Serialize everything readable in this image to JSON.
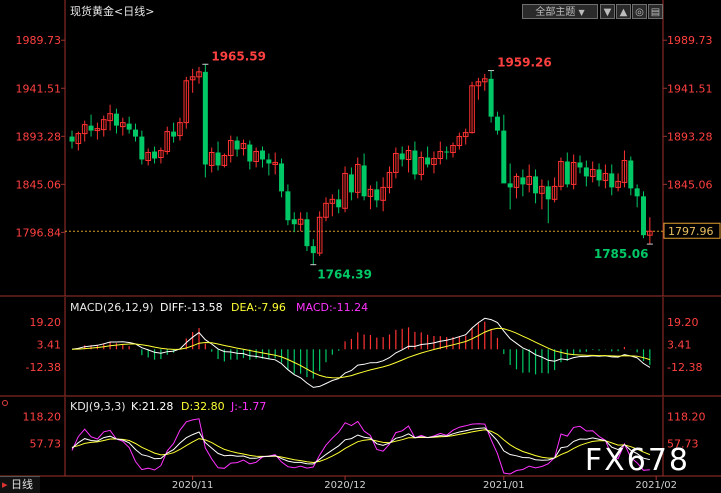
{
  "header": {
    "instrument": "现货黄金",
    "period": "<日线>",
    "theme_button": "全部主题",
    "theme_arrow": "▼",
    "theme_arrow_icon": "dropdown-triangle-icon",
    "nav_buttons": [
      "▼",
      "▲",
      "◎",
      "▤"
    ]
  },
  "watermark": "FX678",
  "bottom_tab": "日线",
  "colors": {
    "up": "#ff3232",
    "down": "#00c866",
    "diff": "#ffffff",
    "dea": "#ffff33",
    "macd": "#ff33ff",
    "k": "#ffffff",
    "d": "#ffff33",
    "j": "#ff33ff",
    "axis": "#a0322d",
    "price_label": "#ff4040"
  },
  "chart_data": [
    {
      "type": "candlestick",
      "title": "现货黄金<日线>",
      "y_ticks": [
        "1989.73",
        "1941.51",
        "1893.28",
        "1845.06",
        "1796.84"
      ],
      "ylim": [
        1745,
        2002
      ],
      "x_ticks": [
        {
          "label": "2020/11",
          "index": 19
        },
        {
          "label": "2020/12",
          "index": 43
        },
        {
          "label": "2021/01",
          "index": 68
        },
        {
          "label": "2021/02",
          "index": 92
        }
      ],
      "annotations": [
        {
          "text": "1965.59",
          "index": 21,
          "value": 1965.59,
          "kind": "high"
        },
        {
          "text": "1764.39",
          "index": 38,
          "value": 1764.39,
          "kind": "low"
        },
        {
          "text": "1959.26",
          "index": 66,
          "value": 1959.26,
          "kind": "high"
        },
        {
          "text": "1785.06",
          "index": 91,
          "value": 1785.06,
          "kind": "low"
        }
      ],
      "current_price": "1797.96",
      "candles": [
        {
          "o": 1893,
          "h": 1899,
          "l": 1881,
          "c": 1888
        },
        {
          "o": 1886,
          "h": 1898,
          "l": 1879,
          "c": 1896
        },
        {
          "o": 1896,
          "h": 1909,
          "l": 1888,
          "c": 1905
        },
        {
          "o": 1904,
          "h": 1915,
          "l": 1893,
          "c": 1899
        },
        {
          "o": 1899,
          "h": 1907,
          "l": 1890,
          "c": 1901
        },
        {
          "o": 1900,
          "h": 1914,
          "l": 1893,
          "c": 1910
        },
        {
          "o": 1909,
          "h": 1925,
          "l": 1899,
          "c": 1916
        },
        {
          "o": 1916,
          "h": 1921,
          "l": 1896,
          "c": 1904
        },
        {
          "o": 1903,
          "h": 1912,
          "l": 1894,
          "c": 1907
        },
        {
          "o": 1906,
          "h": 1913,
          "l": 1896,
          "c": 1900
        },
        {
          "o": 1900,
          "h": 1906,
          "l": 1888,
          "c": 1893
        },
        {
          "o": 1893,
          "h": 1899,
          "l": 1865,
          "c": 1870
        },
        {
          "o": 1869,
          "h": 1881,
          "l": 1864,
          "c": 1877
        },
        {
          "o": 1878,
          "h": 1883,
          "l": 1866,
          "c": 1871
        },
        {
          "o": 1872,
          "h": 1882,
          "l": 1866,
          "c": 1879
        },
        {
          "o": 1878,
          "h": 1903,
          "l": 1875,
          "c": 1898
        },
        {
          "o": 1898,
          "h": 1907,
          "l": 1887,
          "c": 1893
        },
        {
          "o": 1894,
          "h": 1912,
          "l": 1889,
          "c": 1907
        },
        {
          "o": 1907,
          "h": 1953,
          "l": 1901,
          "c": 1949
        },
        {
          "o": 1950,
          "h": 1961,
          "l": 1937,
          "c": 1953
        },
        {
          "o": 1953,
          "h": 1963,
          "l": 1946,
          "c": 1958
        },
        {
          "o": 1958,
          "h": 1966,
          "l": 1852,
          "c": 1865
        },
        {
          "o": 1864,
          "h": 1882,
          "l": 1857,
          "c": 1877
        },
        {
          "o": 1877,
          "h": 1888,
          "l": 1859,
          "c": 1864
        },
        {
          "o": 1864,
          "h": 1876,
          "l": 1862,
          "c": 1874
        },
        {
          "o": 1874,
          "h": 1894,
          "l": 1867,
          "c": 1889
        },
        {
          "o": 1889,
          "h": 1893,
          "l": 1873,
          "c": 1880
        },
        {
          "o": 1881,
          "h": 1890,
          "l": 1874,
          "c": 1886
        },
        {
          "o": 1885,
          "h": 1889,
          "l": 1860,
          "c": 1868
        },
        {
          "o": 1868,
          "h": 1882,
          "l": 1862,
          "c": 1878
        },
        {
          "o": 1879,
          "h": 1883,
          "l": 1862,
          "c": 1870
        },
        {
          "o": 1870,
          "h": 1876,
          "l": 1854,
          "c": 1866
        },
        {
          "o": 1865,
          "h": 1877,
          "l": 1855,
          "c": 1867
        },
        {
          "o": 1866,
          "h": 1871,
          "l": 1832,
          "c": 1838
        },
        {
          "o": 1838,
          "h": 1845,
          "l": 1804,
          "c": 1809
        },
        {
          "o": 1810,
          "h": 1817,
          "l": 1797,
          "c": 1805
        },
        {
          "o": 1805,
          "h": 1817,
          "l": 1798,
          "c": 1810
        },
        {
          "o": 1810,
          "h": 1817,
          "l": 1778,
          "c": 1783
        },
        {
          "o": 1783,
          "h": 1790,
          "l": 1764,
          "c": 1776
        },
        {
          "o": 1776,
          "h": 1818,
          "l": 1773,
          "c": 1812
        },
        {
          "o": 1812,
          "h": 1832,
          "l": 1808,
          "c": 1826
        },
        {
          "o": 1826,
          "h": 1835,
          "l": 1813,
          "c": 1830
        },
        {
          "o": 1830,
          "h": 1840,
          "l": 1816,
          "c": 1822
        },
        {
          "o": 1821,
          "h": 1863,
          "l": 1817,
          "c": 1856
        },
        {
          "o": 1855,
          "h": 1862,
          "l": 1829,
          "c": 1837
        },
        {
          "o": 1837,
          "h": 1872,
          "l": 1831,
          "c": 1865
        },
        {
          "o": 1864,
          "h": 1876,
          "l": 1829,
          "c": 1833
        },
        {
          "o": 1833,
          "h": 1844,
          "l": 1820,
          "c": 1840
        },
        {
          "o": 1840,
          "h": 1848,
          "l": 1822,
          "c": 1829
        },
        {
          "o": 1829,
          "h": 1852,
          "l": 1818,
          "c": 1842
        },
        {
          "o": 1842,
          "h": 1863,
          "l": 1836,
          "c": 1857
        },
        {
          "o": 1857,
          "h": 1882,
          "l": 1851,
          "c": 1876
        },
        {
          "o": 1876,
          "h": 1883,
          "l": 1863,
          "c": 1870
        },
        {
          "o": 1870,
          "h": 1884,
          "l": 1857,
          "c": 1879
        },
        {
          "o": 1879,
          "h": 1888,
          "l": 1850,
          "c": 1855
        },
        {
          "o": 1855,
          "h": 1878,
          "l": 1849,
          "c": 1872
        },
        {
          "o": 1872,
          "h": 1883,
          "l": 1862,
          "c": 1865
        },
        {
          "o": 1865,
          "h": 1878,
          "l": 1856,
          "c": 1871
        },
        {
          "o": 1871,
          "h": 1888,
          "l": 1865,
          "c": 1878
        },
        {
          "o": 1878,
          "h": 1883,
          "l": 1870,
          "c": 1877
        },
        {
          "o": 1877,
          "h": 1887,
          "l": 1872,
          "c": 1884
        },
        {
          "o": 1884,
          "h": 1897,
          "l": 1880,
          "c": 1893
        },
        {
          "o": 1893,
          "h": 1901,
          "l": 1885,
          "c": 1897
        },
        {
          "o": 1897,
          "h": 1948,
          "l": 1896,
          "c": 1944
        },
        {
          "o": 1944,
          "h": 1952,
          "l": 1930,
          "c": 1948
        },
        {
          "o": 1948,
          "h": 1956,
          "l": 1939,
          "c": 1951
        },
        {
          "o": 1951,
          "h": 1959,
          "l": 1907,
          "c": 1913
        },
        {
          "o": 1913,
          "h": 1918,
          "l": 1895,
          "c": 1899
        },
        {
          "o": 1899,
          "h": 1915,
          "l": 1852,
          "c": 1846
        },
        {
          "o": 1846,
          "h": 1866,
          "l": 1820,
          "c": 1842
        },
        {
          "o": 1842,
          "h": 1856,
          "l": 1831,
          "c": 1853
        },
        {
          "o": 1852,
          "h": 1860,
          "l": 1833,
          "c": 1845
        },
        {
          "o": 1845,
          "h": 1865,
          "l": 1837,
          "c": 1853
        },
        {
          "o": 1853,
          "h": 1860,
          "l": 1826,
          "c": 1836
        },
        {
          "o": 1836,
          "h": 1850,
          "l": 1820,
          "c": 1843
        },
        {
          "o": 1843,
          "h": 1849,
          "l": 1806,
          "c": 1830
        },
        {
          "o": 1830,
          "h": 1852,
          "l": 1827,
          "c": 1843
        },
        {
          "o": 1843,
          "h": 1872,
          "l": 1839,
          "c": 1868
        },
        {
          "o": 1868,
          "h": 1877,
          "l": 1842,
          "c": 1845
        },
        {
          "o": 1845,
          "h": 1875,
          "l": 1840,
          "c": 1867
        },
        {
          "o": 1867,
          "h": 1874,
          "l": 1856,
          "c": 1862
        },
        {
          "o": 1862,
          "h": 1869,
          "l": 1843,
          "c": 1853
        },
        {
          "o": 1853,
          "h": 1868,
          "l": 1847,
          "c": 1860
        },
        {
          "o": 1860,
          "h": 1866,
          "l": 1843,
          "c": 1849
        },
        {
          "o": 1849,
          "h": 1865,
          "l": 1841,
          "c": 1856
        },
        {
          "o": 1856,
          "h": 1865,
          "l": 1834,
          "c": 1842
        },
        {
          "o": 1842,
          "h": 1856,
          "l": 1838,
          "c": 1848
        },
        {
          "o": 1847,
          "h": 1879,
          "l": 1842,
          "c": 1869
        },
        {
          "o": 1869,
          "h": 1873,
          "l": 1834,
          "c": 1841
        },
        {
          "o": 1841,
          "h": 1845,
          "l": 1822,
          "c": 1833
        },
        {
          "o": 1833,
          "h": 1838,
          "l": 1791,
          "c": 1794
        },
        {
          "o": 1794,
          "h": 1812,
          "l": 1785,
          "c": 1798
        }
      ]
    },
    {
      "type": "macd",
      "title": "MACD(26,12,9)",
      "diff_label": "DIFF:-13.58",
      "dea_label": "DEA:-7.96",
      "macd_label": "MACD:-11.24",
      "y_ticks": [
        "19.20",
        "3.41",
        "-12.38"
      ],
      "tick_values": [
        19.2,
        3.41,
        -12.38
      ],
      "ylim": [
        -30,
        29
      ]
    },
    {
      "type": "kdj",
      "title": "KDJ(9,3,3)",
      "k_label": "K:21.28",
      "d_label": "D:32.80",
      "j_label": "J:-1.77",
      "y_ticks": [
        "118.20",
        "57.73"
      ],
      "tick_values": [
        118.2,
        57.73
      ],
      "ylim": [
        -12,
        138
      ]
    }
  ]
}
